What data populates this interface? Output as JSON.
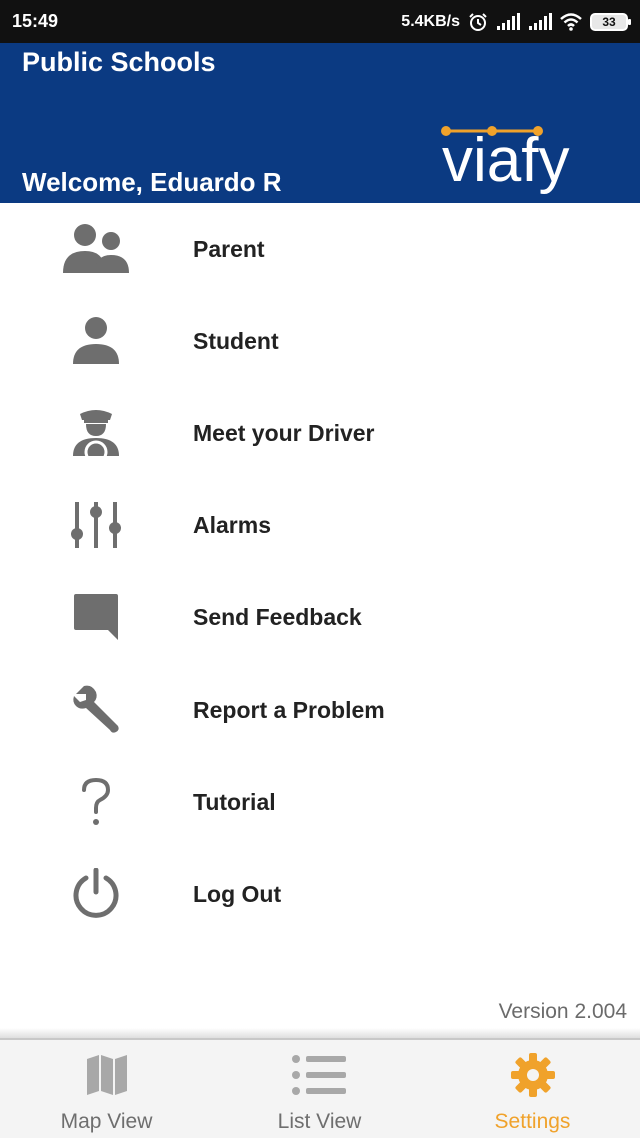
{
  "status_bar": {
    "time": "15:49",
    "network_speed": "5.4KB/s",
    "battery": "33",
    "icons": [
      "alarm-icon",
      "signal-icon",
      "signal-icon",
      "wifi-icon",
      "battery-icon"
    ]
  },
  "header": {
    "title": "Public Schools",
    "welcome": "Welcome, Eduardo R",
    "logo_text": "viafy",
    "background_color": "#0b3a82",
    "logo_accent_color": "#f0a22b"
  },
  "menu": {
    "items": [
      {
        "label": "Parent",
        "icon": "parent-group-icon"
      },
      {
        "label": "Student",
        "icon": "student-person-icon"
      },
      {
        "label": "Meet your Driver",
        "icon": "driver-icon"
      },
      {
        "label": "Alarms",
        "icon": "sliders-icon"
      },
      {
        "label": "Send Feedback",
        "icon": "chat-bubble-icon"
      },
      {
        "label": "Report a Problem",
        "icon": "wrench-icon"
      },
      {
        "label": "Tutorial",
        "icon": "question-icon"
      },
      {
        "label": "Log Out",
        "icon": "power-icon"
      }
    ],
    "icon_color": "#6e6e6e"
  },
  "version": "Version 2.004",
  "bottom_nav": {
    "items": [
      {
        "label": "Map View",
        "icon": "map-icon",
        "active": false
      },
      {
        "label": "List View",
        "icon": "list-icon",
        "active": false
      },
      {
        "label": "Settings",
        "icon": "gear-icon",
        "active": true
      }
    ],
    "active_color": "#f0a22b"
  }
}
